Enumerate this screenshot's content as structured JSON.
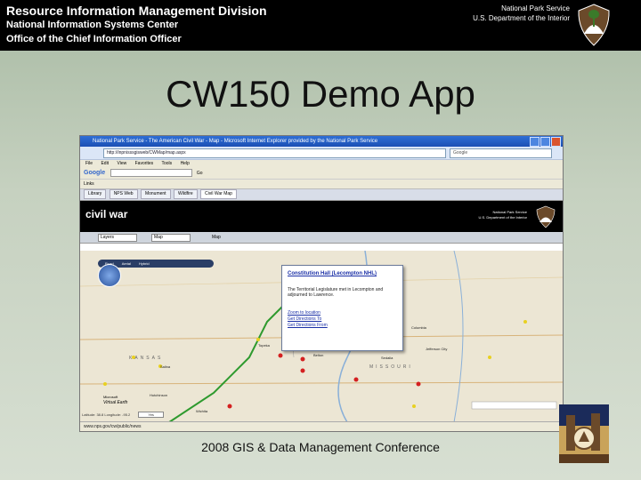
{
  "header": {
    "division": "Resource Information Management Division",
    "center": "National Information Systems Center",
    "office": "Office of the Chief Information Officer",
    "agency": "National Park Service",
    "department": "U.S. Department of the Interior"
  },
  "slide_title": "CW150 Demo App",
  "footer": "2008 GIS & Data Management Conference",
  "browser": {
    "window_title": "National Park Service - The American Civil War - Map - Microsoft Internet Explorer provided by the National Park Service",
    "address": "http://inpnisssgisweb/CWMap/map.aspx",
    "search_placeholder": "Google",
    "menu": [
      "File",
      "Edit",
      "View",
      "Favorites",
      "Tools",
      "Help"
    ],
    "google_label": "Google",
    "google_go": "Go",
    "links_label": "Links",
    "tabs": [
      "Library",
      "NPS Web",
      "Monument",
      "Wildfire",
      "Civil War Map"
    ],
    "status_text": "www.nps.gov/cw/public/news"
  },
  "app": {
    "title": "civil war",
    "agency": "National Park Service",
    "department": "U.S. Department of the Interior",
    "toolbar_select1": "Layers",
    "toolbar_select2": "Map",
    "toolbar_tab": "Map",
    "map_controls": [
      "Road",
      "Aerial",
      "Hybrid"
    ],
    "popup": {
      "title": "Constitution Hall (Lecompton NHL)",
      "desc": "The Territorial Legislature met in Lecompton and adjourned to Lawrence.",
      "links": [
        "Zoom to location",
        "Get Directions To",
        "Get Directions From"
      ]
    },
    "map_labels": [
      "KANSAS",
      "MISSOURI",
      "Wichita",
      "Hutchinson",
      "Salina",
      "Topeka",
      "Belton",
      "Sedalia",
      "Jefferson City",
      "Columbia",
      "Virtual Earth",
      "Microsoft"
    ],
    "coords_text": "Latitude: 38.8 Longitude: -95.2",
    "zoom_select": "Yes"
  },
  "colors": {
    "nps_brown": "#6b4a2a",
    "header_bg": "#000000",
    "ie_title_blue": "#1b4fb4",
    "route_green": "#2e9a2e",
    "marker_red": "#d42020",
    "marker_yellow": "#e8d020"
  },
  "icons": [
    "nps-arrowhead-icon",
    "compass-icon",
    "search-icon",
    "close-icon"
  ]
}
